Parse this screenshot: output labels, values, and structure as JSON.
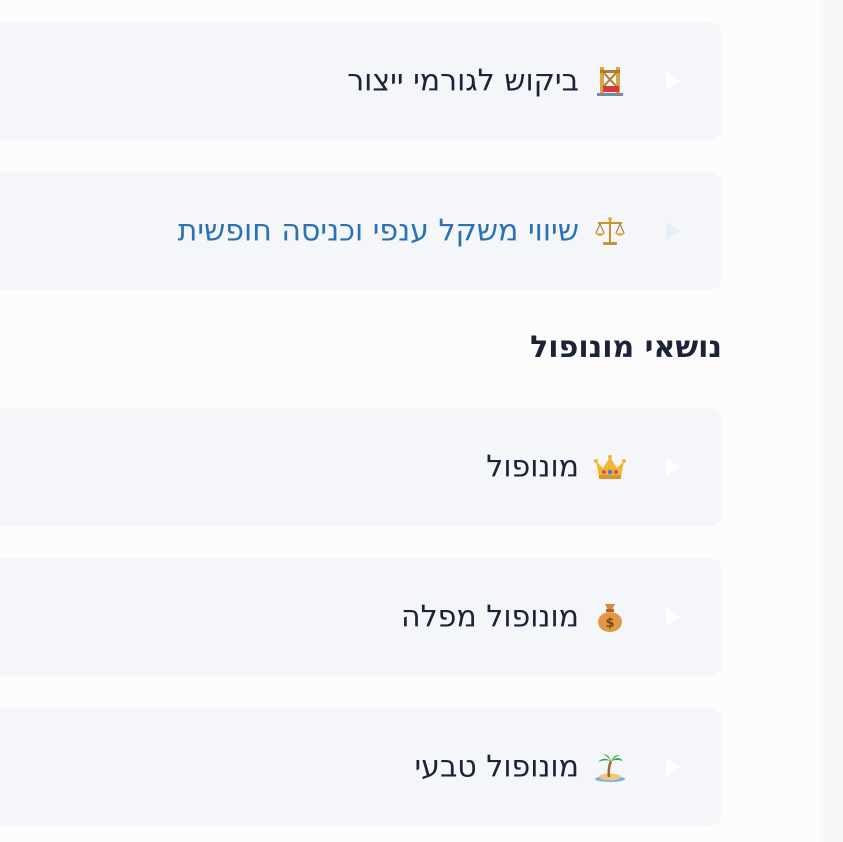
{
  "cards_top": [
    {
      "label": "ביקוש לגורמי ייצור",
      "icon": "construction-crane-icon",
      "link": false
    },
    {
      "label": "שיווי משקל ענפי וכניסה חופשית",
      "icon": "balance-scale-icon",
      "link": true
    }
  ],
  "section": {
    "heading": "נושאי מונופול"
  },
  "cards_bottom": [
    {
      "label": "מונופול",
      "icon": "crown-icon",
      "link": false
    },
    {
      "label": "מונופול מפלה",
      "icon": "money-bag-icon",
      "link": false
    },
    {
      "label": "מונופול טבעי",
      "icon": "desert-island-icon",
      "link": false
    }
  ],
  "colors": {
    "text": "#1a2338",
    "link": "#2a72b8",
    "card_bg": "#f4f6f9",
    "page_bg": "#fcfcfc"
  }
}
